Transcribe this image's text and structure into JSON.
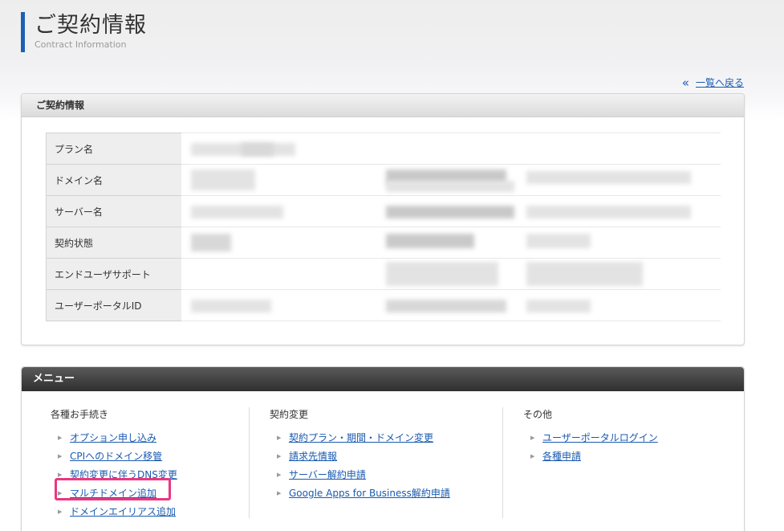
{
  "header": {
    "title": "ご契約情報",
    "subtitle": "Contract Information"
  },
  "back_link": {
    "icon": "double-chevron-left-icon",
    "label": "一覧へ戻る"
  },
  "contract_panel": {
    "heading": "ご契約情報",
    "rows": [
      {
        "label": "プラン名"
      },
      {
        "label": "ドメイン名"
      },
      {
        "label": "サーバー名"
      },
      {
        "label": "契約状態"
      },
      {
        "label": "エンドユーザサポート"
      },
      {
        "label": "ユーザーポータルID"
      }
    ]
  },
  "menu_panel": {
    "heading": "メニュー",
    "columns": [
      {
        "title": "各種お手続き",
        "items": [
          "オプション申し込み",
          "CPIへのドメイン移管",
          "契約変更に伴うDNS変更",
          "マルチドメイン追加",
          "ドメインエイリアス追加"
        ]
      },
      {
        "title": "契約変更",
        "items": [
          "契約プラン・期間・ドメイン変更",
          "請求先情報",
          "サーバー解約申請",
          "Google Apps for Business解約申請"
        ]
      },
      {
        "title": "その他",
        "items": [
          "ユーザーポータルログイン",
          "各種申請"
        ]
      }
    ],
    "highlight_color": "#ec3680"
  },
  "colors": {
    "accent": "#1d5fb7",
    "link": "#1a5bb0"
  }
}
